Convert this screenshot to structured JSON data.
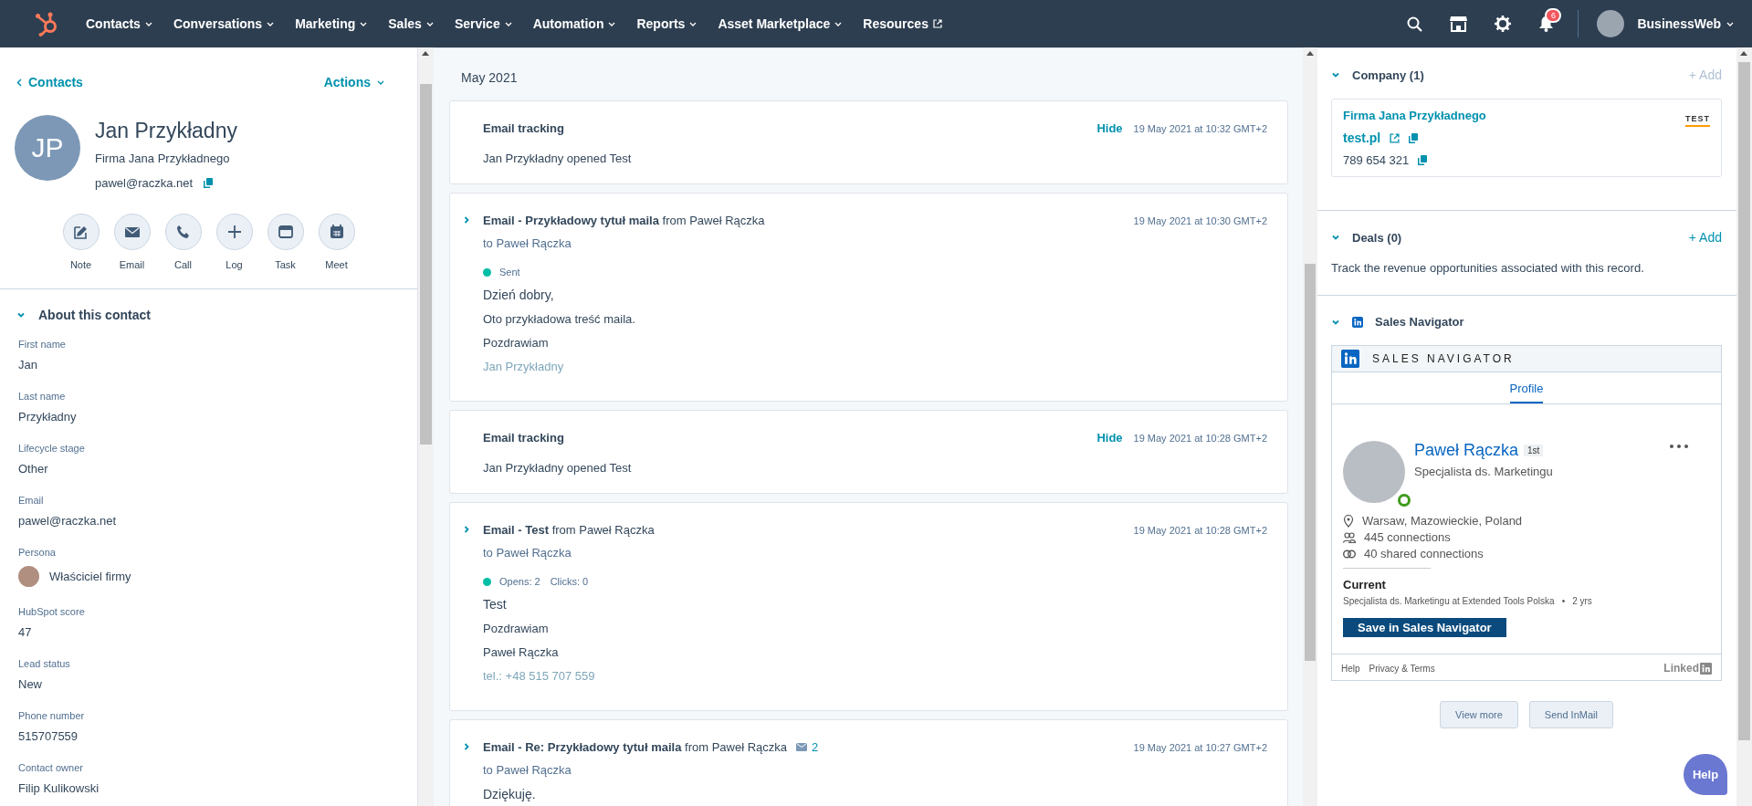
{
  "nav": {
    "items": [
      {
        "label": "Contacts",
        "kind": "menu"
      },
      {
        "label": "Conversations",
        "kind": "menu"
      },
      {
        "label": "Marketing",
        "kind": "menu"
      },
      {
        "label": "Sales",
        "kind": "menu"
      },
      {
        "label": "Service",
        "kind": "menu"
      },
      {
        "label": "Automation",
        "kind": "menu"
      },
      {
        "label": "Reports",
        "kind": "menu"
      },
      {
        "label": "Asset Marketplace",
        "kind": "menu"
      },
      {
        "label": "Resources",
        "kind": "external"
      }
    ],
    "notifications": "6",
    "account": "BusinessWeb"
  },
  "contact": {
    "back": "Contacts",
    "actions": "Actions",
    "initials": "JP",
    "name": "Jan Przykładny",
    "company": "Firma Jana Przykładnego",
    "email": "pawel@raczka.net",
    "quick_actions": [
      {
        "label": "Note",
        "kind": "note"
      },
      {
        "label": "Email",
        "kind": "email"
      },
      {
        "label": "Call",
        "kind": "call"
      },
      {
        "label": "Log",
        "kind": "log"
      },
      {
        "label": "Task",
        "kind": "task"
      },
      {
        "label": "Meet",
        "kind": "meet"
      }
    ]
  },
  "about": {
    "title": "About this contact",
    "expanded": true,
    "fields": [
      {
        "label": "First name",
        "value": "Jan",
        "kind": "text"
      },
      {
        "label": "Last name",
        "value": "Przykładny",
        "kind": "text"
      },
      {
        "label": "Lifecycle stage",
        "value": "Other",
        "kind": "text"
      },
      {
        "label": "Email",
        "value": "pawel@raczka.net",
        "kind": "text"
      },
      {
        "label": "Persona",
        "value": "Właściciel firmy",
        "kind": "persona"
      },
      {
        "label": "HubSpot score",
        "value": "47",
        "kind": "text"
      },
      {
        "label": "Lead status",
        "value": "New",
        "kind": "text"
      },
      {
        "label": "Phone number",
        "value": "515707559",
        "kind": "text"
      },
      {
        "label": "Contact owner",
        "value": "Filip Kulikowski",
        "kind": "text"
      }
    ]
  },
  "timeline": {
    "month": "May 2021",
    "entries": [
      {
        "kind": "tracking",
        "title": "Email tracking",
        "action": "Hide",
        "time": "19 May 2021 at 10:32 GMT+2",
        "text": "Jan Przykładny opened Test"
      },
      {
        "kind": "email",
        "expanded": false,
        "subject": "**Email - Przykładowy tytuł maila** from Paweł Rączka",
        "to": "to Paweł Rączka",
        "stats": [
          "Sent"
        ],
        "time": "19 May 2021 at 10:30 GMT+2",
        "body": [
          {
            "text": "Dzień dobry,",
            "faded": false
          },
          {
            "text": "Oto przykładowa treść maila.",
            "faded": false
          },
          {
            "text": "Pozdrawiam",
            "faded": false
          },
          {
            "text": "Jan Przykładny",
            "faded": true
          }
        ]
      },
      {
        "kind": "tracking",
        "title": "Email tracking",
        "action": "Hide",
        "time": "19 May 2021 at 10:28 GMT+2",
        "text": "Jan Przykładny opened Test"
      },
      {
        "kind": "email",
        "expanded": false,
        "subject": "**Email - Test** from Paweł Rączka",
        "to": "to Paweł Rączka",
        "stats": [
          "Opens: 2",
          "Clicks: 0"
        ],
        "time": "19 May 2021 at 10:28 GMT+2",
        "body": [
          {
            "text": "Test",
            "faded": false
          },
          {
            "text": "Pozdrawiam",
            "faded": false
          },
          {
            "text": "Paweł Rączka",
            "faded": false
          },
          {
            "text": "tel.: +48 515 707 559",
            "faded": true
          }
        ]
      },
      {
        "kind": "email",
        "expanded": false,
        "subject": "**Email - Re: Przykładowy tytuł maila** from Paweł Rączka",
        "thread_count": "2",
        "to": "to Paweł Rączka",
        "time": "19 May 2021 at 10:27 GMT+2",
        "body": [
          {
            "text": "Dziękuję.",
            "faded": false
          }
        ]
      }
    ]
  },
  "company": {
    "title": "Company (1)",
    "expanded": true,
    "add": "+ Add",
    "add_disabled": true,
    "name": "Firma Jana Przykładnego",
    "domain": "test.pl",
    "phone": "789 654 321",
    "logo_text": "TEST"
  },
  "deals": {
    "title": "Deals (0)",
    "expanded": true,
    "add": "+ Add",
    "add_disabled": false,
    "description": "Track the revenue opportunities associated with this record."
  },
  "sales_navigator": {
    "title": "Sales Navigator",
    "expanded": true,
    "header": "SALES NAVIGATOR",
    "tabs": [
      {
        "label": "Profile",
        "selected": true
      }
    ],
    "name": "Paweł Rączka",
    "degree": "1st",
    "headline": "Specjalista ds. Marketingu",
    "online": true,
    "location": "Warsaw, Mazowieckie, Poland",
    "connections": "445 connections",
    "shared": "40 shared connections",
    "current_label": "Current",
    "position": "Specjalista ds. Marketingu at Extended Tools Polska",
    "separator": "•",
    "duration": "2 yrs",
    "save": "Save in Sales Navigator",
    "footer_links": [
      "Help",
      "Privacy & Terms"
    ],
    "brand": "Linked",
    "buttons": [
      "View more",
      "Send InMail"
    ]
  },
  "help_button": "Help"
}
